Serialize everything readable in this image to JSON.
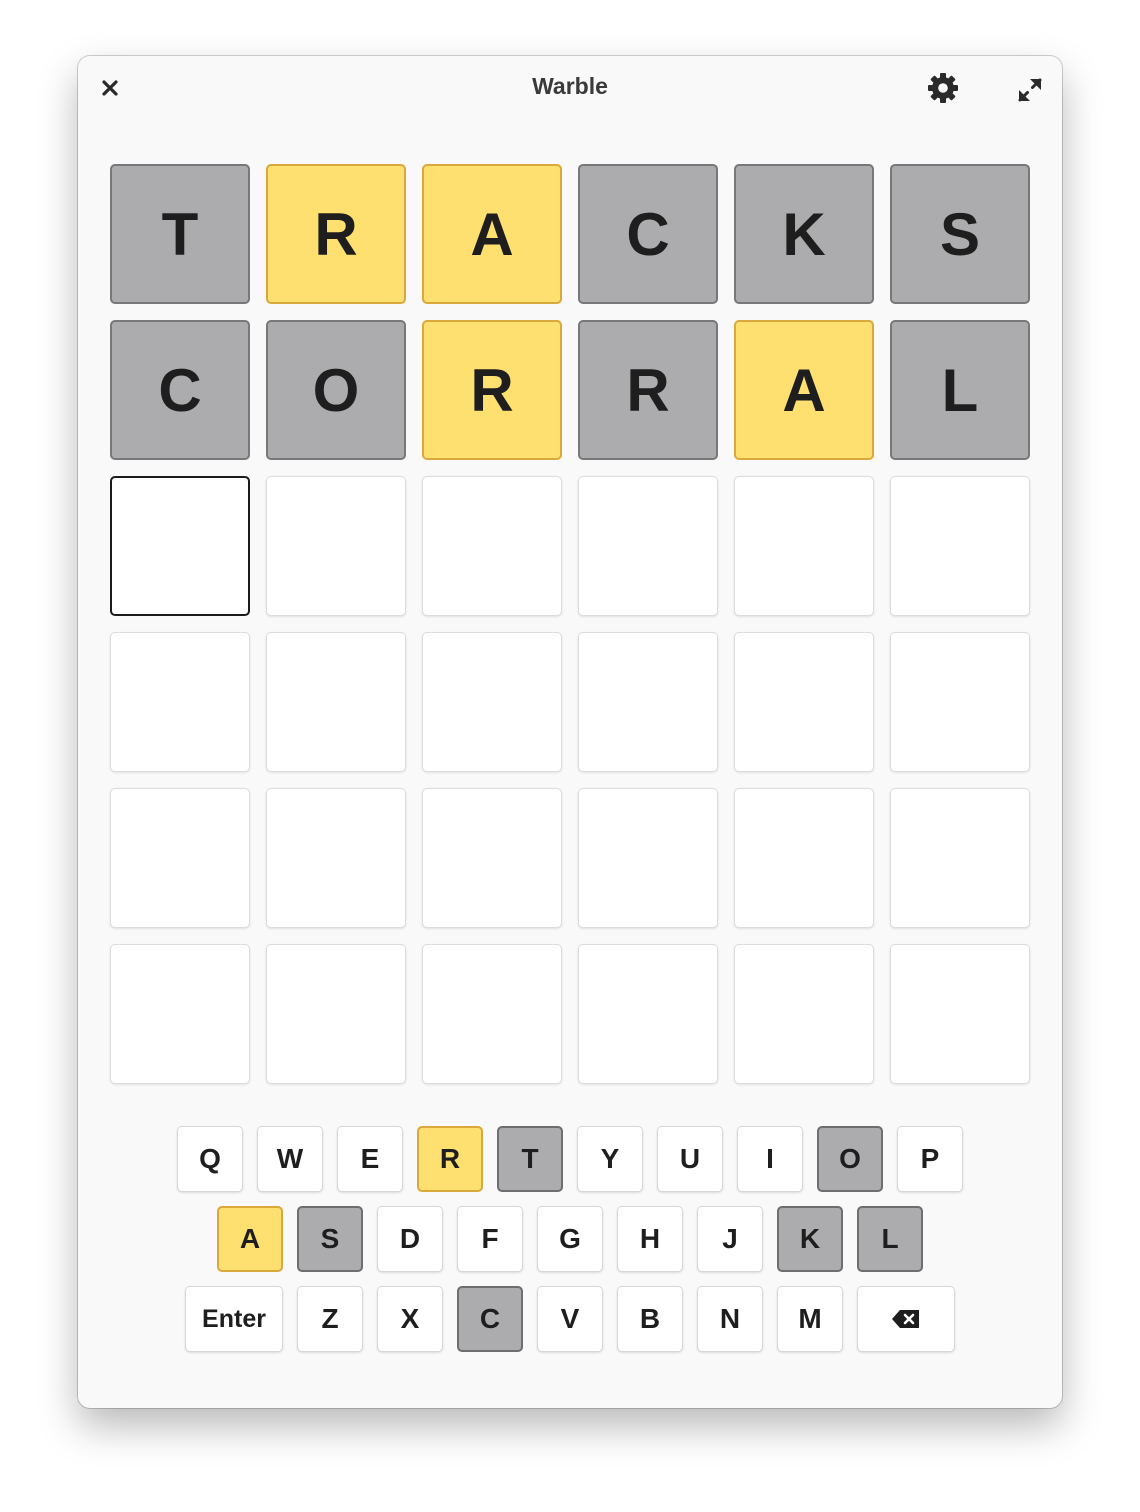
{
  "window": {
    "title": "Warble",
    "icons": {
      "close": "close-icon",
      "settings": "gear-icon",
      "fullscreen": "expand-icon"
    }
  },
  "colors": {
    "absent": "#acacae",
    "present": "#fde06f",
    "empty": "#ffffff",
    "text": "#1e1e1e"
  },
  "board": {
    "rows": [
      [
        {
          "letter": "T",
          "state": "absent"
        },
        {
          "letter": "R",
          "state": "present"
        },
        {
          "letter": "A",
          "state": "present"
        },
        {
          "letter": "C",
          "state": "absent"
        },
        {
          "letter": "K",
          "state": "absent"
        },
        {
          "letter": "S",
          "state": "absent"
        }
      ],
      [
        {
          "letter": "C",
          "state": "absent"
        },
        {
          "letter": "O",
          "state": "absent"
        },
        {
          "letter": "R",
          "state": "present"
        },
        {
          "letter": "R",
          "state": "absent"
        },
        {
          "letter": "A",
          "state": "present"
        },
        {
          "letter": "L",
          "state": "absent"
        }
      ],
      [
        {
          "letter": "",
          "state": "cursor"
        },
        {
          "letter": "",
          "state": "empty"
        },
        {
          "letter": "",
          "state": "empty"
        },
        {
          "letter": "",
          "state": "empty"
        },
        {
          "letter": "",
          "state": "empty"
        },
        {
          "letter": "",
          "state": "empty"
        }
      ],
      [
        {
          "letter": "",
          "state": "empty"
        },
        {
          "letter": "",
          "state": "empty"
        },
        {
          "letter": "",
          "state": "empty"
        },
        {
          "letter": "",
          "state": "empty"
        },
        {
          "letter": "",
          "state": "empty"
        },
        {
          "letter": "",
          "state": "empty"
        }
      ],
      [
        {
          "letter": "",
          "state": "empty"
        },
        {
          "letter": "",
          "state": "empty"
        },
        {
          "letter": "",
          "state": "empty"
        },
        {
          "letter": "",
          "state": "empty"
        },
        {
          "letter": "",
          "state": "empty"
        },
        {
          "letter": "",
          "state": "empty"
        }
      ],
      [
        {
          "letter": "",
          "state": "empty"
        },
        {
          "letter": "",
          "state": "empty"
        },
        {
          "letter": "",
          "state": "empty"
        },
        {
          "letter": "",
          "state": "empty"
        },
        {
          "letter": "",
          "state": "empty"
        },
        {
          "letter": "",
          "state": "empty"
        }
      ]
    ]
  },
  "keyboard": {
    "rows": [
      [
        {
          "label": "Q",
          "state": "unused"
        },
        {
          "label": "W",
          "state": "unused"
        },
        {
          "label": "E",
          "state": "unused"
        },
        {
          "label": "R",
          "state": "present"
        },
        {
          "label": "T",
          "state": "absent"
        },
        {
          "label": "Y",
          "state": "unused"
        },
        {
          "label": "U",
          "state": "unused"
        },
        {
          "label": "I",
          "state": "unused"
        },
        {
          "label": "O",
          "state": "absent"
        },
        {
          "label": "P",
          "state": "unused"
        }
      ],
      [
        {
          "label": "A",
          "state": "present"
        },
        {
          "label": "S",
          "state": "absent"
        },
        {
          "label": "D",
          "state": "unused"
        },
        {
          "label": "F",
          "state": "unused"
        },
        {
          "label": "G",
          "state": "unused"
        },
        {
          "label": "H",
          "state": "unused"
        },
        {
          "label": "J",
          "state": "unused"
        },
        {
          "label": "K",
          "state": "absent"
        },
        {
          "label": "L",
          "state": "absent"
        }
      ],
      [
        {
          "label": "Enter",
          "state": "unused",
          "special": "enter"
        },
        {
          "label": "Z",
          "state": "unused"
        },
        {
          "label": "X",
          "state": "unused"
        },
        {
          "label": "C",
          "state": "absent"
        },
        {
          "label": "V",
          "state": "unused"
        },
        {
          "label": "B",
          "state": "unused"
        },
        {
          "label": "N",
          "state": "unused"
        },
        {
          "label": "M",
          "state": "unused"
        },
        {
          "label": "",
          "state": "unused",
          "special": "backspace",
          "icon": "backspace-icon"
        }
      ]
    ]
  }
}
